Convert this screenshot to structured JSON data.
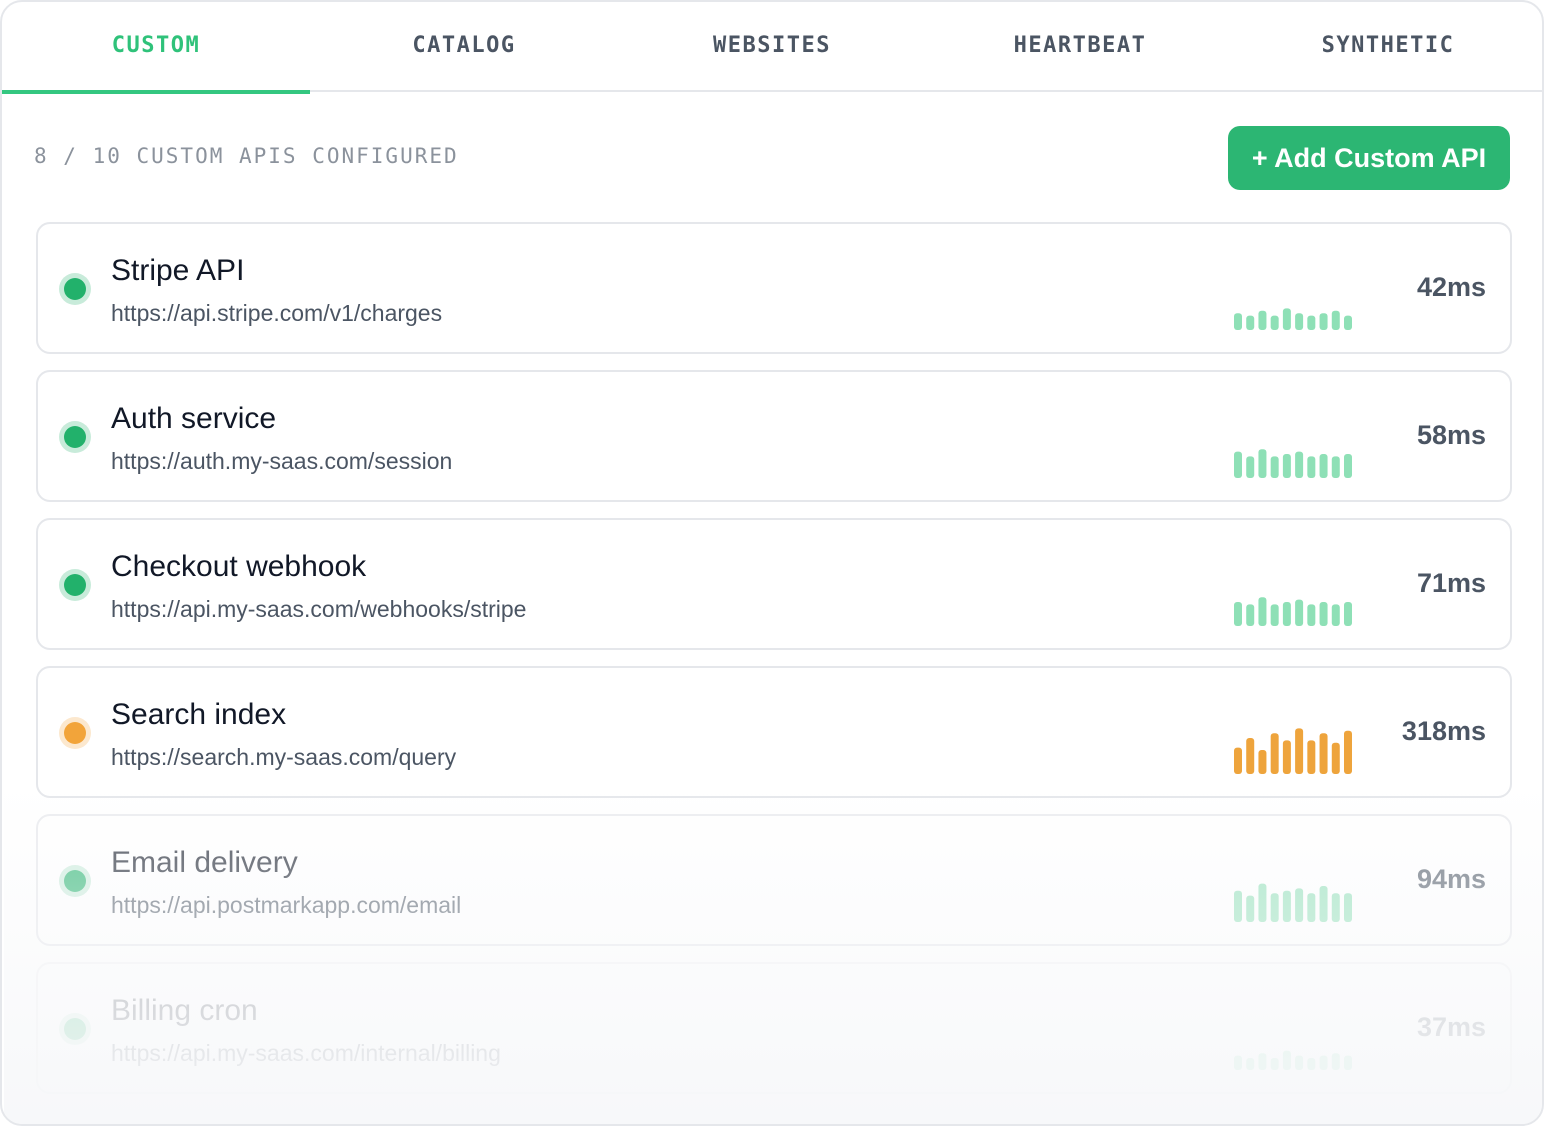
{
  "tabs": [
    {
      "label": "CUSTOM",
      "active": true
    },
    {
      "label": "CATALOG",
      "active": false
    },
    {
      "label": "WEBSITES",
      "active": false
    },
    {
      "label": "HEARTBEAT",
      "active": false
    },
    {
      "label": "SYNTHETIC",
      "active": false
    }
  ],
  "toolbar": {
    "count_label": "8 / 10 CUSTOM APIS CONFIGURED",
    "add_button": "+ Add Custom API"
  },
  "colors": {
    "accent": "#2cb673",
    "ok": "#22b16b",
    "ok_bar": "#8ee0b6",
    "warn": "#f2a43a",
    "warn_bar": "#eea43c"
  },
  "apis": [
    {
      "name": "Stripe API",
      "url": "https://api.stripe.com/v1/charges",
      "latency": "42ms",
      "status": "ok",
      "bars": [
        0.35,
        0.3,
        0.4,
        0.3,
        0.45,
        0.35,
        0.3,
        0.35,
        0.4,
        0.3
      ]
    },
    {
      "name": "Auth service",
      "url": "https://auth.my-saas.com/session",
      "latency": "58ms",
      "status": "ok",
      "bars": [
        0.55,
        0.45,
        0.6,
        0.45,
        0.5,
        0.55,
        0.45,
        0.5,
        0.45,
        0.5
      ]
    },
    {
      "name": "Checkout webhook",
      "url": "https://api.my-saas.com/webhooks/stripe",
      "latency": "71ms",
      "status": "ok",
      "bars": [
        0.5,
        0.45,
        0.6,
        0.45,
        0.5,
        0.55,
        0.45,
        0.5,
        0.45,
        0.5
      ]
    },
    {
      "name": "Search index",
      "url": "https://search.my-saas.com/query",
      "latency": "318ms",
      "status": "warn",
      "bars": [
        0.55,
        0.75,
        0.5,
        0.85,
        0.7,
        0.95,
        0.7,
        0.85,
        0.65,
        0.9
      ]
    },
    {
      "name": "Email delivery",
      "url": "https://api.postmarkapp.com/email",
      "latency": "94ms",
      "status": "ok",
      "bars": [
        0.65,
        0.55,
        0.8,
        0.6,
        0.65,
        0.7,
        0.6,
        0.75,
        0.6,
        0.6
      ]
    },
    {
      "name": "Billing cron",
      "url": "https://api.my-saas.com/internal/billing",
      "latency": "37ms",
      "status": "ok",
      "bars": [
        0.3,
        0.25,
        0.35,
        0.25,
        0.4,
        0.3,
        0.25,
        0.3,
        0.35,
        0.3
      ]
    }
  ]
}
